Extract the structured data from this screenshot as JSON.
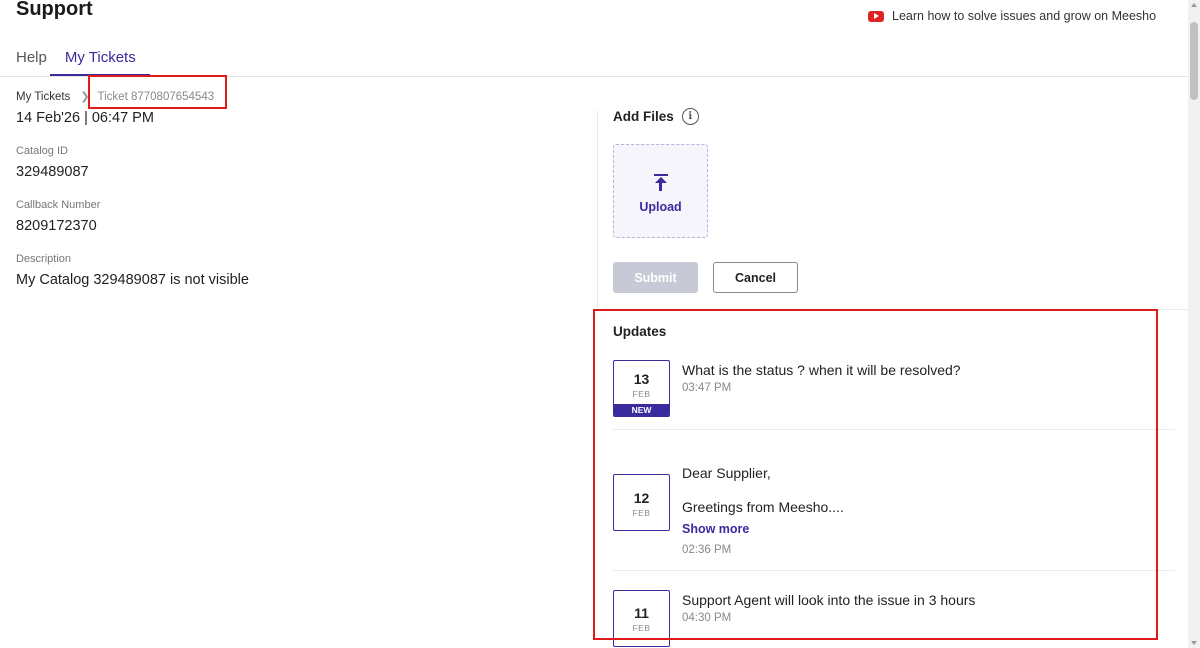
{
  "header": {
    "title": "Support",
    "learn_link": "Learn how to solve issues and grow on Meesho"
  },
  "tabs": [
    {
      "label": "Help"
    },
    {
      "label": "My Tickets"
    }
  ],
  "breadcrumb": {
    "parent": "My Tickets",
    "current": "Ticket 8770807654543"
  },
  "ticket": {
    "date": "14 Feb'26 | 06:47 PM",
    "catalog_label": "Catalog ID",
    "catalog_value": "329489087",
    "callback_label": "Callback Number",
    "callback_value": "8209172370",
    "description_label": "Description",
    "description_value": "My Catalog 329489087 is not visible"
  },
  "files": {
    "title": "Add Files",
    "upload_label": "Upload",
    "submit_label": "Submit",
    "cancel_label": "Cancel"
  },
  "updates": {
    "title": "Updates",
    "items": [
      {
        "day": "13",
        "month": "FEB",
        "badge": "NEW",
        "message": "What is the status ? when it will be resolved?",
        "time": "03:47 PM"
      },
      {
        "day": "12",
        "month": "FEB",
        "message_line1": "Dear Supplier,",
        "message_line2": "Greetings from Meesho....",
        "show_more": "Show more",
        "time": "02:36 PM"
      },
      {
        "day": "11",
        "month": "FEB",
        "message": "Support Agent will look into the issue in 3 hours",
        "time": "04:30 PM"
      }
    ]
  },
  "colors": {
    "accent": "#3a2b9f",
    "highlight_box": "#e01b1b",
    "youtube_red": "#e02424"
  }
}
